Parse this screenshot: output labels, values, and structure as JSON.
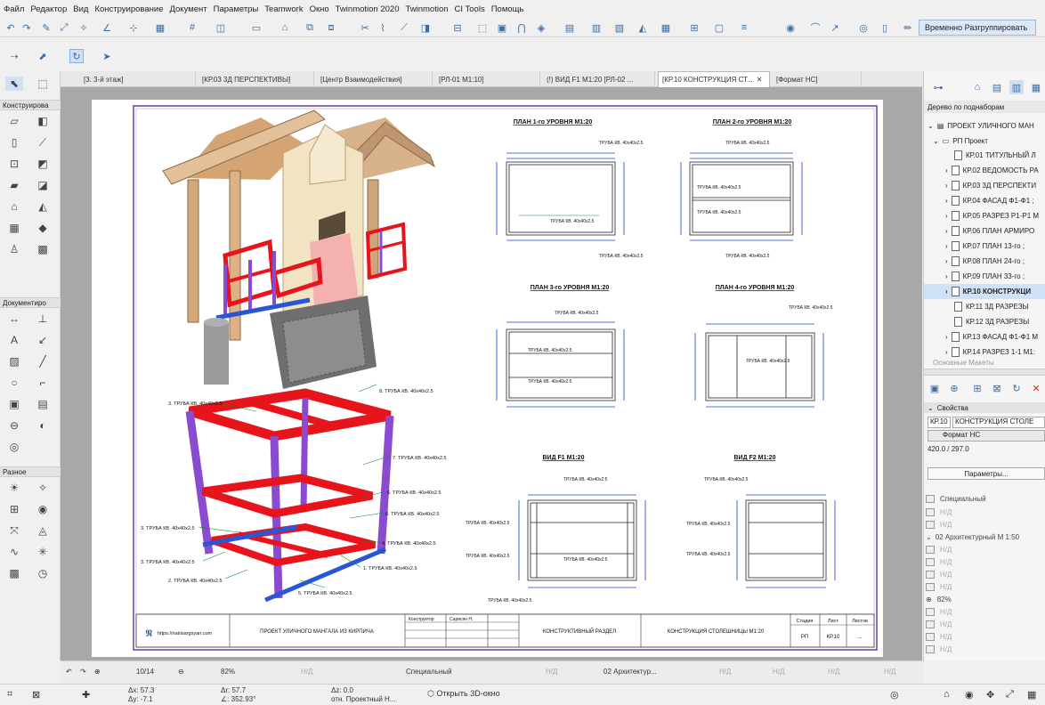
{
  "menu": [
    "Файл",
    "Редактор",
    "Вид",
    "Конструирование",
    "Документ",
    "Параметры",
    "Teamwork",
    "Окно",
    "Twinmotion 2020",
    "Twinmotion",
    "CI Tools",
    "Помощь"
  ],
  "toolbar": {
    "regroup_label": "Временно Разгруппировать"
  },
  "tabs": [
    "[3. 3-й этаж]",
    "[КР.03 3Д ПЕРСПЕКТИВЫ]",
    "[Центр Взаимодействия]",
    "[РЛ-01 М1:10]",
    "(!) ВИД F1 М1:20 [РЛ-02 ...",
    "[КР.10 КОНСТРУКЦИЯ СТ...",
    "[Формат НС]"
  ],
  "left": {
    "sections": [
      "Конструирова",
      "Документиро",
      "Разное"
    ]
  },
  "nav": {
    "header": "Дерево по поднаборам",
    "root": "ПРОЕКТ УЛИЧНОГО МАН",
    "sub": "РП Проект",
    "items": [
      "КР.01 ТИТУЛЬНЫЙ Л",
      "КР.02 ВЕДОМОСТЬ РА",
      "КР.03 3Д ПЕРСПЕКТИ",
      "КР.04 ФАСАД Ф1-Ф1 ;",
      "КР.05 РАЗРЕЗ Р1-Р1 М",
      "КР.06 ПЛАН АРМИРО",
      "КР.07 ПЛАН 13-го ;",
      "КР.08 ПЛАН 24-го ;",
      "КР.09 ПЛАН 33-го ;",
      "КР.10 КОНСТРУКЦИ",
      "КР.11 3Д РАЗРЕЗЫ",
      "КР.12 3Д РАЗРЕЗЫ",
      "КР.13 ФАСАД Ф1-Ф1 М",
      "КР.14 РАЗРЕЗ 1-1 М1:"
    ],
    "sub2": "Основные Макеты"
  },
  "props": {
    "header": "Свойства",
    "id": "КР.10",
    "name": "КОНСТРУКЦИЯ СТОЛЕ",
    "format": "Формат НС",
    "size": "420.0 / 297.0",
    "params_btn": "Параметры...",
    "special": "Специальный",
    "nd": "Н/Д",
    "arch": "02 Архитектурный М 1:50",
    "zoom": "82%"
  },
  "status": {
    "page": "10/14",
    "zoom": "82%",
    "nd": "Н/Д",
    "special": "Специальный",
    "arch": "02 Архитектур..."
  },
  "coords": {
    "dx": "Δx: 57.3",
    "dy": "Δy: -7.1",
    "dr": "Δr: 57.7",
    "da": "∠: 352.93°",
    "dz": "Δz: 0.0",
    "rel": "отн. Проектный Н...",
    "open3d": "Открыть 3D-окно"
  },
  "sheet": {
    "plan_titles": [
      "ПЛАН 1-го УРОВНЯ  М1:20",
      "ПЛАН 2-го УРОВНЯ  М1:20",
      "ПЛАН 3-го УРОВНЯ  М1:20",
      "ПЛАН 4-го УРОВНЯ  М1:20",
      "ВИД F1 М1:20",
      "ВИД F2 М1:20"
    ],
    "labels3d": [
      "8. ТРУБА КВ. 40х40х2.5",
      "3. ТРУБА КВ. 40х40х2.5",
      "7. ТРУБА КВ. 40х40х2.5",
      "6. ТРУБА КВ. 40х40х2.5",
      "6. ТРУБА КВ. 40х40х2.5",
      "3. ТРУБА КВ. 40х40х2.5",
      "4. ТРУБА КВ. 40х40х2.5",
      "3. ТРУБА КВ. 40х40х2.5",
      "1. ТРУБА КВ. 40х40х2.5",
      "2. ТРУБА КВ. 40х40х2.5",
      "5. ТРУБА КВ. 40х40х2.5"
    ],
    "pipe": "ТРУБА КВ. 40х40х2.5",
    "title_block": {
      "site": "https://nairisargsyan.com",
      "project": "ПРОЕКТ УЛИЧНОГО МАНГАЛА ИЗ КИРПИЧА",
      "role": "Конструктор",
      "author": "Сарисян Н.",
      "section": "КОНСТРУКТИВНЫЙ РАЗДЕЛ",
      "sheet_name": "КОНСТРУКЦИЯ СТОЛЕШНИЦЫ М1:20",
      "stage_h": "Стадия",
      "sheet_h": "Лист",
      "sheets_h": "Листов",
      "stage": "РП",
      "sheet": "КР.10",
      "sheets": "..."
    }
  },
  "colors": {
    "accent": "#3a6ea5",
    "red": "#e8141c",
    "purple": "#8a4bd0",
    "blue": "#2a56d6"
  }
}
